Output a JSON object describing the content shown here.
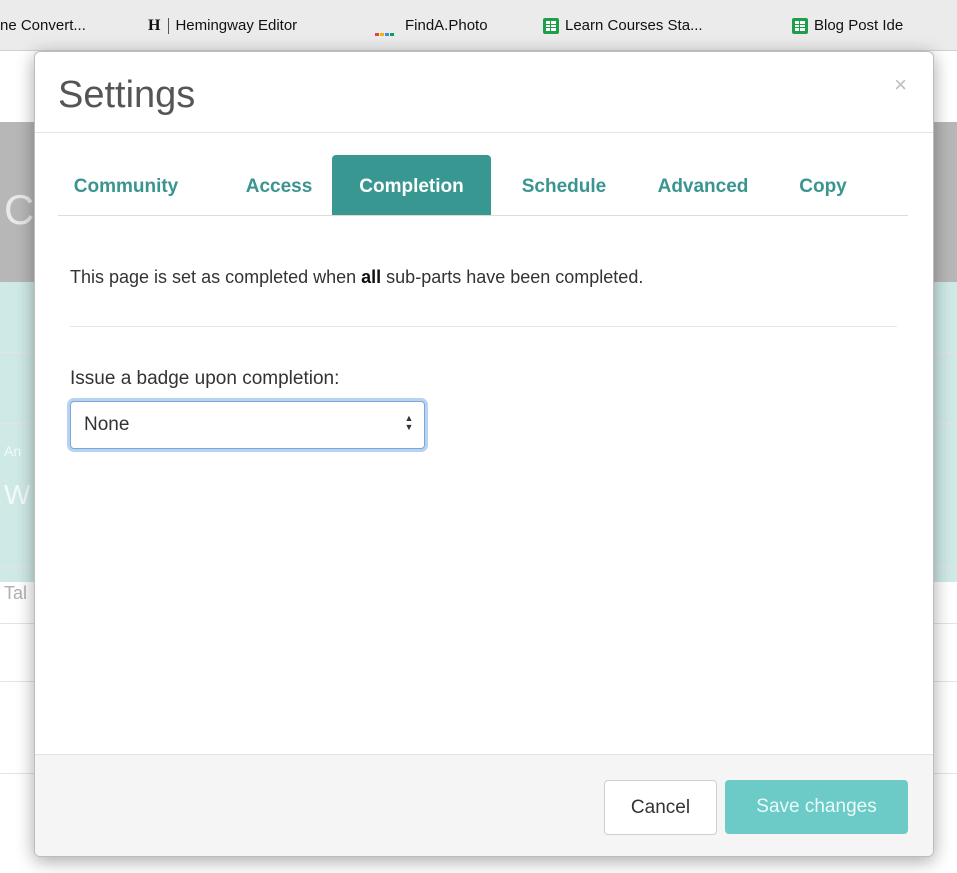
{
  "bookmarks": [
    {
      "label": "ne Convert...",
      "icon": "none"
    },
    {
      "label": "Hemingway Editor",
      "icon": "hemingway-h-icon",
      "icon_text": "H"
    },
    {
      "label": "FindA.Photo",
      "icon": "findaphoto-dots-icon"
    },
    {
      "label": "Learn Courses Sta...",
      "icon": "google-sheets-icon"
    },
    {
      "label": "Blog Post Ide",
      "icon": "google-sheets-icon"
    }
  ],
  "modal": {
    "title": "Settings",
    "close_symbol": "×",
    "tabs": [
      {
        "label": "Community",
        "active": false
      },
      {
        "label": "Access",
        "active": false
      },
      {
        "label": "Completion",
        "active": true
      },
      {
        "label": "Schedule",
        "active": false
      },
      {
        "label": "Advanced",
        "active": false
      },
      {
        "label": "Copy",
        "active": false
      }
    ],
    "completion": {
      "desc_prefix": "This page is set as completed when ",
      "desc_bold": "all",
      "desc_suffix": " sub-parts have been completed.",
      "badge_label": "Issue a badge upon completion:",
      "badge_selected": "None"
    },
    "footer": {
      "cancel_label": "Cancel",
      "save_label": "Save changes"
    }
  },
  "background_fragments": [
    "C",
    "An",
    "W",
    "Tal"
  ],
  "colors": {
    "accent": "#399792",
    "tab_text": "#3a9590",
    "save_button": "#6ccbc6",
    "sheets_green": "#1e9e4a"
  }
}
